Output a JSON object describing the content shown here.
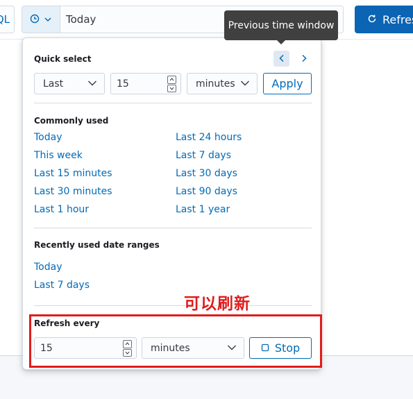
{
  "topbar": {
    "query_lang_label": "QL",
    "date_value": "Today",
    "refresh_label": "Refresh"
  },
  "tooltip": {
    "text": "Previous time window"
  },
  "quick_select": {
    "title": "Quick select",
    "direction": "Last",
    "amount": "15",
    "unit": "minutes",
    "apply_label": "Apply"
  },
  "commonly_used": {
    "title": "Commonly used",
    "left": [
      "Today",
      "This week",
      "Last 15 minutes",
      "Last 30 minutes",
      "Last 1 hour"
    ],
    "right": [
      "Last 24 hours",
      "Last 7 days",
      "Last 30 days",
      "Last 90 days",
      "Last 1 year"
    ]
  },
  "recently_used": {
    "title": "Recently used date ranges",
    "items": [
      "Today",
      "Last 7 days"
    ]
  },
  "refresh_every": {
    "title": "Refresh every",
    "amount": "15",
    "unit": "minutes",
    "stop_label": "Stop"
  },
  "annotation": {
    "text": "可以刷新"
  },
  "colors": {
    "accent": "#006bb8",
    "primary_button": "#0b64b4",
    "annotation": "#e11b1b",
    "tooltip_bg": "#404040"
  },
  "icons": [
    "clock-icon",
    "chevron-down-icon",
    "refresh-icon",
    "chevron-left-icon",
    "chevron-right-icon",
    "stop-icon"
  ]
}
